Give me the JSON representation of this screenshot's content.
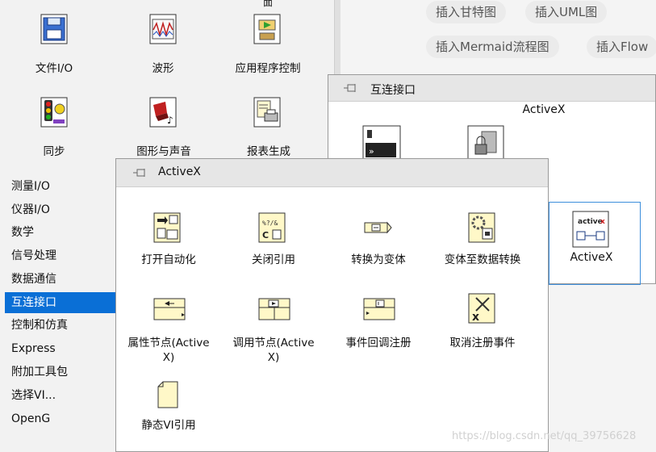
{
  "editor": {
    "chips": [
      {
        "label": "插入甘特图"
      },
      {
        "label": "插入UML图"
      },
      {
        "label": "插入Mermaid流程图"
      },
      {
        "label": "插入Flow"
      }
    ]
  },
  "top_palette": {
    "top_cut_label": "面",
    "items": [
      {
        "label": "文件I/O",
        "icon": "floppy-disk-icon"
      },
      {
        "label": "波形",
        "icon": "waveform-icon"
      },
      {
        "label": "应用程序控制",
        "icon": "app-control-icon"
      },
      {
        "label": "同步",
        "icon": "traffic-light-icon"
      },
      {
        "label": "图形与声音",
        "icon": "graphics-sound-icon"
      },
      {
        "label": "报表生成",
        "icon": "report-printer-icon"
      }
    ]
  },
  "categories": [
    {
      "label": "测量I/O"
    },
    {
      "label": "仪器I/O"
    },
    {
      "label": "数学"
    },
    {
      "label": "信号处理"
    },
    {
      "label": "数据通信"
    },
    {
      "label": "互连接口",
      "selected": true
    },
    {
      "label": "控制和仿真"
    },
    {
      "label": "Express"
    },
    {
      "label": "附加工具包"
    },
    {
      "label": "选择VI..."
    },
    {
      "label": "OpenG"
    }
  ],
  "right_panel": {
    "title": "互连接口",
    "subtitle": "ActiveX",
    "items": [
      {
        "label": "ActiveX",
        "icon": "activex-icon"
      }
    ]
  },
  "front_panel": {
    "title": "ActiveX",
    "items": [
      {
        "label": "打开自动化",
        "icon": "open-automation-icon"
      },
      {
        "label": "关闭引用",
        "icon": "close-reference-icon"
      },
      {
        "label": "转换为变体",
        "icon": "to-variant-icon"
      },
      {
        "label": "变体至数据转换",
        "icon": "variant-to-data-icon"
      },
      {
        "label": "属性节点(Active",
        "label2": "X)",
        "icon": "property-node-icon"
      },
      {
        "label": "调用节点(Active",
        "label2": "X)",
        "icon": "invoke-node-icon"
      },
      {
        "label": "事件回调注册",
        "icon": "event-callback-icon"
      },
      {
        "label": "取消注册事件",
        "icon": "unregister-event-icon"
      },
      {
        "label": "静态VI引用",
        "icon": "static-vi-reference-icon"
      }
    ]
  },
  "watermark": "https://blog.csdn.net/qq_39756628"
}
